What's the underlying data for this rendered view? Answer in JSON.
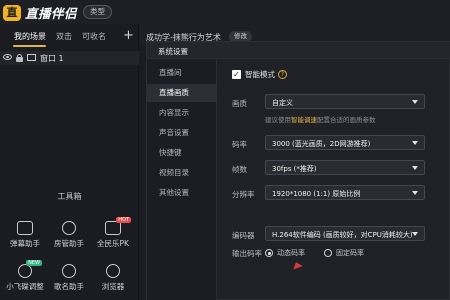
{
  "app": {
    "logo_glyph": "直",
    "name": "直播伴侣",
    "type_button": "类型"
  },
  "left_panel": {
    "tabs": [
      "我的场景",
      "双击",
      "可收名"
    ],
    "add_label": "+",
    "scene": {
      "label": "窗口 1"
    }
  },
  "toolbox": {
    "title": "工具箱",
    "tools": [
      {
        "label": "弹幕助手",
        "icon": "danmaku-icon"
      },
      {
        "label": "房管助手",
        "icon": "room-admin-icon"
      },
      {
        "label": "全民乐PK",
        "icon": "pk-icon",
        "badge": "HOT"
      },
      {
        "label": "小飞碟调整",
        "icon": "ufo-icon",
        "badge": "NEW"
      },
      {
        "label": "歌名助手",
        "icon": "song-icon"
      },
      {
        "label": "浏览器",
        "icon": "browser-icon"
      }
    ]
  },
  "scene_bar": {
    "title": "成功学-抹熊行为艺术",
    "edit": "修改"
  },
  "dialog": {
    "title": "系统设置",
    "nav": [
      "直播间",
      "直播画质",
      "内容显示",
      "声音设置",
      "快捷键",
      "视频目录",
      "其他设置"
    ],
    "active_nav": "直播画质",
    "smart_mode": {
      "label": "智能模式",
      "checked": true,
      "help": "?"
    },
    "fields": {
      "quality": {
        "label": "画质",
        "value": "自定义"
      },
      "hint": {
        "prefix": "建议使用",
        "highlight": "智能调速",
        "suffix": "配置合适的画质参数"
      },
      "bitrate": {
        "label": "码率",
        "value": "3000 (蓝光画质，2D网游推荐)"
      },
      "fps": {
        "label": "帧数",
        "value": "30fps (*推荐)"
      },
      "resolution": {
        "label": "分辨率",
        "value": "1920*1080 (1:1) 原始比例"
      },
      "encoder": {
        "label": "编码器",
        "value": "H.264软件编码 (画质较好，对CPU消耗较大)"
      }
    },
    "output_bitrate": {
      "label": "输出码率",
      "options": [
        "动态码率",
        "固定码率"
      ],
      "selected": "动态码率"
    }
  },
  "colors": {
    "accent": "#e0b54a",
    "background": "#1b1c21",
    "panel": "#202126",
    "highlight": "#e9b446"
  }
}
